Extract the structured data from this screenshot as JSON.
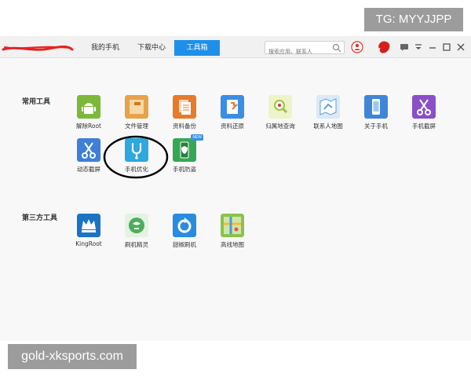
{
  "overlays": {
    "tag": "TG: MYYJJPP",
    "site": "gold-xksports.com"
  },
  "nav": {
    "my_phone": "我的手机",
    "downloads": "下载中心",
    "toolbox": "工具箱"
  },
  "search": {
    "placeholder": "搜索应用、联系人"
  },
  "sections": {
    "common": "常用工具",
    "third_party": "第三方工具"
  },
  "common_tools": [
    {
      "label": "解除Root",
      "icon": "android-icon",
      "color": "#7cb83a"
    },
    {
      "label": "文件管理",
      "icon": "folder-icon",
      "color": "#e8a24a"
    },
    {
      "label": "资料备份",
      "icon": "documents-icon",
      "color": "#e77b2a"
    },
    {
      "label": "资料还原",
      "icon": "restore-icon",
      "color": "#3a8ee6"
    },
    {
      "label": "归属地查询",
      "icon": "magnifier-icon",
      "color": "#9bc43c"
    },
    {
      "label": "联系人地图",
      "icon": "map-icon",
      "color": "#5aa0e0"
    },
    {
      "label": "关于手机",
      "icon": "phone-icon",
      "color": "#3f86d8"
    },
    {
      "label": "手机截屏",
      "icon": "scissors-icon",
      "color": "#8a4fc9"
    },
    {
      "label": "动态截屏",
      "icon": "scissors-icon",
      "color": "#3f7fd8"
    },
    {
      "label": "手机优化",
      "icon": "stethoscope-icon",
      "color": "#2fa8e0"
    },
    {
      "label": "手机防盗",
      "icon": "shield-phone-icon",
      "color": "#35a853",
      "badge": "NEW"
    }
  ],
  "third_party_tools": [
    {
      "label": "KingRoot",
      "icon": "crown-icon",
      "color": "#1c73c4"
    },
    {
      "label": "刷机精灵",
      "icon": "spirit-icon",
      "color": "#4cae5a"
    },
    {
      "label": "甜椒刷机",
      "icon": "refresh-icon",
      "color": "#2a8ce0"
    },
    {
      "label": "高线地图",
      "icon": "map-grid-icon",
      "color": "#8ac24a"
    }
  ],
  "colors": {
    "accent": "#1e90ea",
    "annotation": "#000000",
    "scribble": "#e52222"
  }
}
